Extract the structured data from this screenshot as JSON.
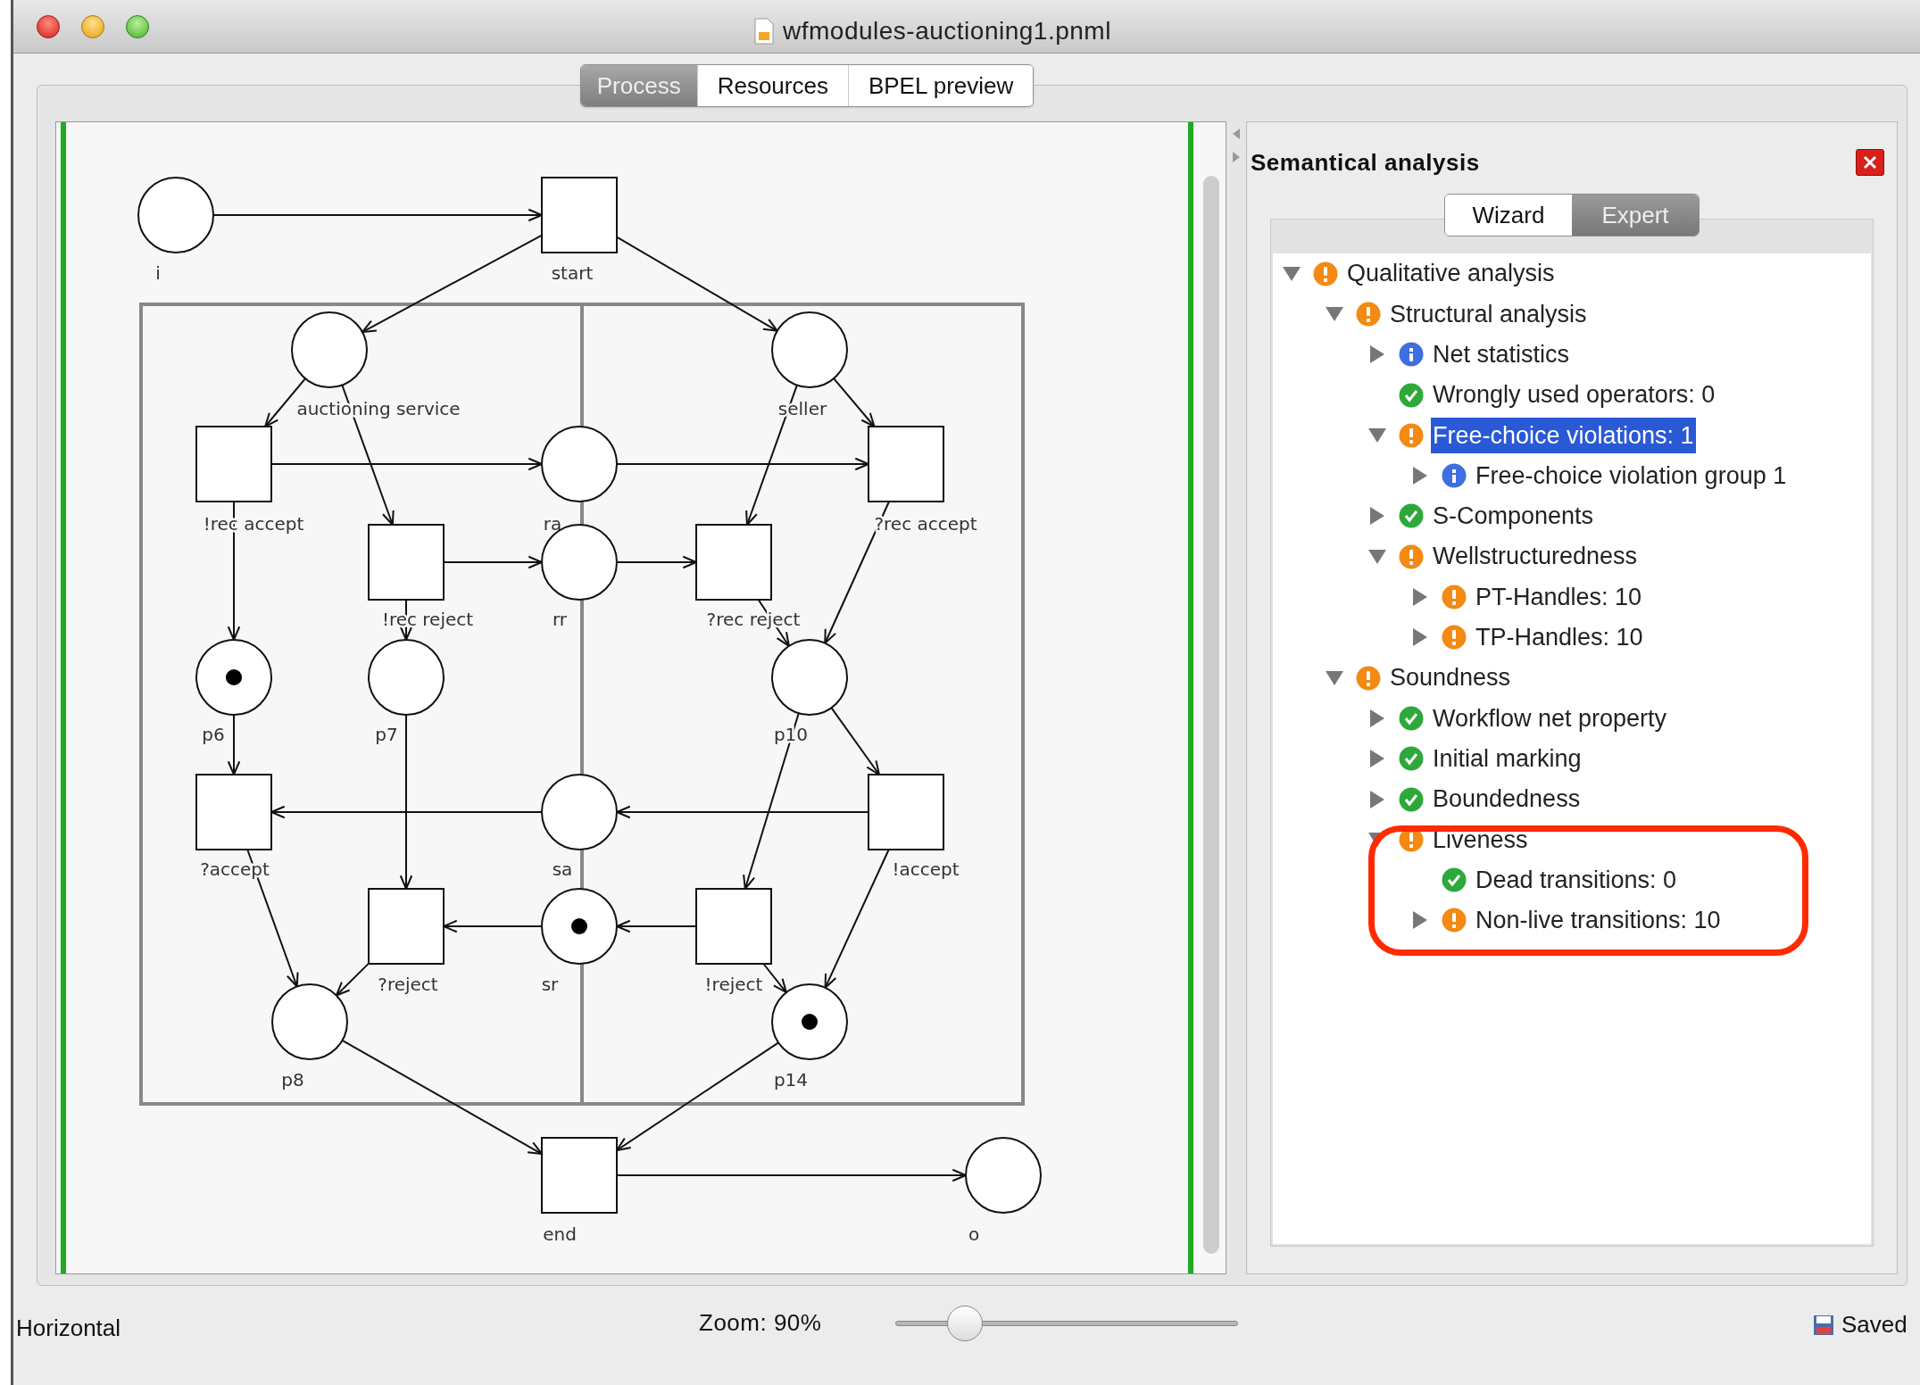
{
  "window": {
    "title": "wfmodules-auctioning1.pnml"
  },
  "tabs": [
    {
      "label": "Process",
      "selected": true
    },
    {
      "label": "Resources",
      "selected": false
    },
    {
      "label": "BPEL preview",
      "selected": false
    }
  ],
  "diagram": {
    "places": [
      {
        "label": "i",
        "marked": false
      },
      {
        "label": "auctioning service",
        "marked": false
      },
      {
        "label": "seller",
        "marked": false
      },
      {
        "label": "ra",
        "marked": false
      },
      {
        "label": "rr",
        "marked": false
      },
      {
        "label": "p6",
        "marked": true
      },
      {
        "label": "p7",
        "marked": false
      },
      {
        "label": "p10",
        "marked": false
      },
      {
        "label": "sa",
        "marked": false
      },
      {
        "label": "sr",
        "marked": true
      },
      {
        "label": "p8",
        "marked": false
      },
      {
        "label": "p14",
        "marked": true
      },
      {
        "label": "o",
        "marked": false
      }
    ],
    "transitions": [
      {
        "label": "start"
      },
      {
        "label": "!rec accept"
      },
      {
        "label": "!rec reject"
      },
      {
        "label": "?rec reject"
      },
      {
        "label": "?rec accept"
      },
      {
        "label": "?accept"
      },
      {
        "label": "!accept"
      },
      {
        "label": "?reject"
      },
      {
        "label": "!reject"
      },
      {
        "label": "end"
      }
    ]
  },
  "analysis": {
    "title": "Semantical analysis",
    "modes": [
      {
        "label": "Wizard",
        "selected": false
      },
      {
        "label": "Expert",
        "selected": true
      }
    ],
    "tree": [
      {
        "label": "Qualitative analysis",
        "kind": "warning",
        "expanded": true,
        "selected": false,
        "children": [
          {
            "label": "Structural analysis",
            "kind": "warning",
            "expanded": true,
            "selected": false,
            "children": [
              {
                "label": "Net statistics",
                "kind": "info",
                "expanded": false,
                "selected": false
              },
              {
                "label": "Wrongly used operators: 0",
                "kind": "ok",
                "selected": false
              },
              {
                "label": "Free-choice violations: 1",
                "kind": "warning",
                "expanded": true,
                "selected": true,
                "children": [
                  {
                    "label": "Free-choice violation group 1",
                    "kind": "info",
                    "expanded": false,
                    "selected": false
                  }
                ]
              },
              {
                "label": "S-Components",
                "kind": "ok",
                "expanded": false,
                "selected": false
              },
              {
                "label": "Wellstructuredness",
                "kind": "warning",
                "expanded": true,
                "selected": false,
                "children": [
                  {
                    "label": "PT-Handles: 10",
                    "kind": "warning",
                    "expanded": false,
                    "selected": false
                  },
                  {
                    "label": "TP-Handles: 10",
                    "kind": "warning",
                    "expanded": false,
                    "selected": false
                  }
                ]
              }
            ]
          },
          {
            "label": "Soundness",
            "kind": "warning",
            "expanded": true,
            "selected": false,
            "children": [
              {
                "label": "Workflow net property",
                "kind": "ok",
                "expanded": false,
                "selected": false
              },
              {
                "label": "Initial marking",
                "kind": "ok",
                "expanded": false,
                "selected": false
              },
              {
                "label": "Boundedness",
                "kind": "ok",
                "expanded": false,
                "selected": false
              },
              {
                "label": "Liveness",
                "kind": "warning",
                "expanded": true,
                "selected": false,
                "children": [
                  {
                    "label": "Dead transitions: 0",
                    "kind": "ok",
                    "selected": false
                  },
                  {
                    "label": "Non-live transitions: 10",
                    "kind": "warning",
                    "expanded": false,
                    "selected": false
                  }
                ]
              }
            ]
          }
        ]
      }
    ]
  },
  "status_bar": {
    "orientation": "Horizontal",
    "zoom_label": "Zoom: 90%",
    "zoom": {
      "level": 0.17
    },
    "save_state": "Saved"
  }
}
